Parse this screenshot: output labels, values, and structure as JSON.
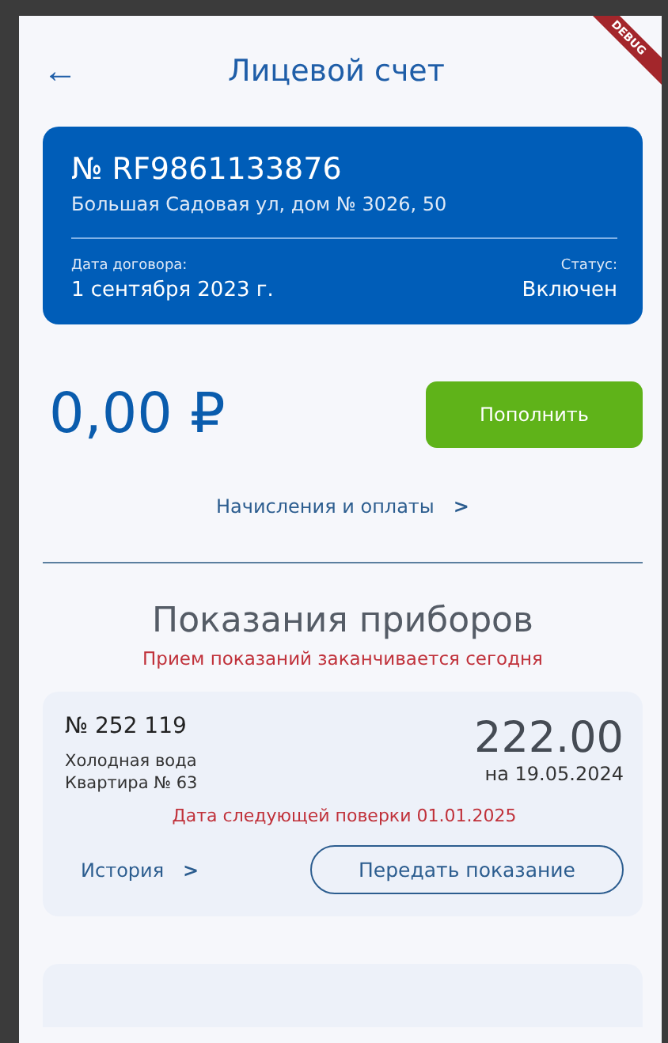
{
  "header": {
    "back": "←",
    "title": "Лицевой счет",
    "debug_banner": "DEBUG"
  },
  "account": {
    "number": "№ RF9861133876",
    "address": "Большая Садовая ул, дом № 3026, 50",
    "contract_label": "Дата договора:",
    "contract_date": "1 сентября 2023 г.",
    "status_label": "Статус:",
    "status": "Включен"
  },
  "balance": {
    "amount": "0,00 ₽",
    "button": "Пополнить"
  },
  "payments_link": {
    "label": "Начисления и оплаты",
    "chevron": ">"
  },
  "meters_section": {
    "title": "Показания приборов",
    "warning": "Прием показаний заканчивается сегодня"
  },
  "meters": [
    {
      "number": "№ 252 119",
      "type": "Холодная вода",
      "apartment": "Квартира № 63",
      "reading": "222.00",
      "reading_date": "на 19.05.2024",
      "next_check": "Дата следующей поверки 01.01.2025",
      "history": "История",
      "history_chevron": ">",
      "submit": "Передать показание"
    }
  ]
}
